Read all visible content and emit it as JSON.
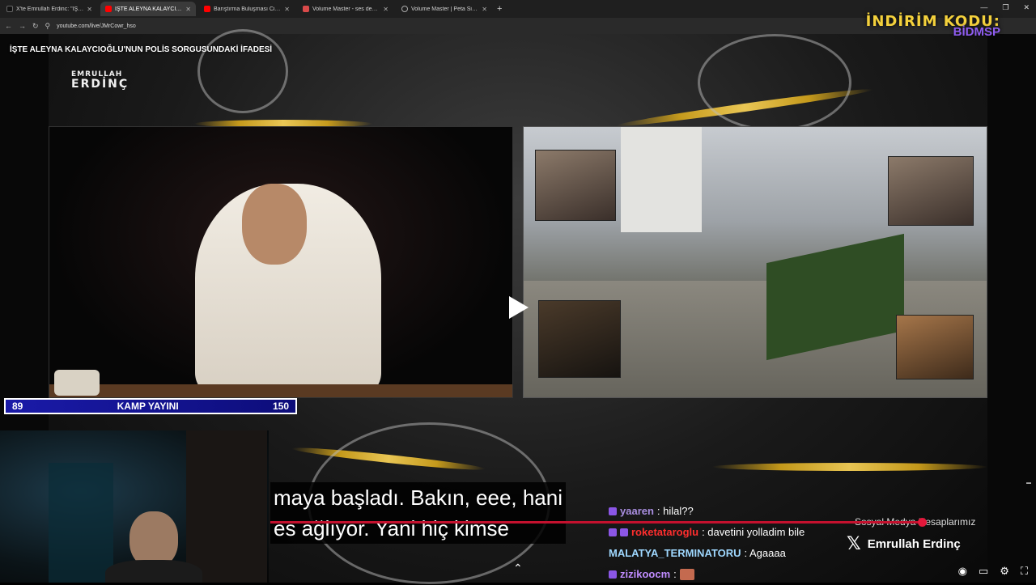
{
  "browser": {
    "tabs": [
      {
        "label": "X'te Emrullah Erdinc: \"İŞTE ALEY...",
        "color": "#111111",
        "active": false
      },
      {
        "label": "İŞTE ALEYNA KALAYCIOĞLU",
        "color": "#ff0000",
        "active": true
      },
      {
        "label": "Barıştırma Buluşması Cinayetle",
        "color": "#ff0000",
        "active": false
      },
      {
        "label": "Volume Master - ses denetleyici",
        "color": "#d94a4a",
        "active": false
      },
      {
        "label": "Volume Master | Peta Sittek",
        "color": "#888888",
        "active": false
      }
    ],
    "new_tab": "+",
    "url": "youtube.com/live/JMrCowr_hso"
  },
  "promo": {
    "line1": "İNDİRİM KODU:",
    "line2": "BİDMSP"
  },
  "stream": {
    "title": "İŞTE ALEYNA KALAYCIOĞLU'NUN POLİS SORGUSUNDAKİ İFADESİ",
    "logo_top": "EMRULLAH",
    "logo_bottom": "ERDİNÇ"
  },
  "camp_bar": {
    "left": "89",
    "label": "KAMP YAYINI",
    "right": "150"
  },
  "subtitles": {
    "line1": "maya başladı. Bakın, eee, hani",
    "line2": "es ağlıyor. Yani hiç kimse"
  },
  "chat": [
    {
      "user": "yaaren",
      "message": ": hilal??",
      "user_color": "#a98ee0"
    },
    {
      "user": "roketataroglu",
      "message": ": davetini yolladim bile",
      "user_color": "#ff2e2e"
    },
    {
      "user": "MALATYA_TERMINATORU",
      "message": ": Agaaaa",
      "user_color": "#9fd8ff"
    },
    {
      "user": "zizikoocm",
      "message": ":",
      "user_color": "#c08cff"
    }
  ],
  "social": {
    "label": "Sosyal Medya Hesaplarımız",
    "handle": "Emrullah Erdinç"
  },
  "icons": {
    "play": "play-icon",
    "back": "back-arrow-icon",
    "forward": "forward-arrow-icon",
    "reload": "reload-icon",
    "collapse": "chevron-up-icon",
    "settings": "gear-icon",
    "fullscreen": "fullscreen-icon",
    "subtitles": "cc-icon"
  }
}
